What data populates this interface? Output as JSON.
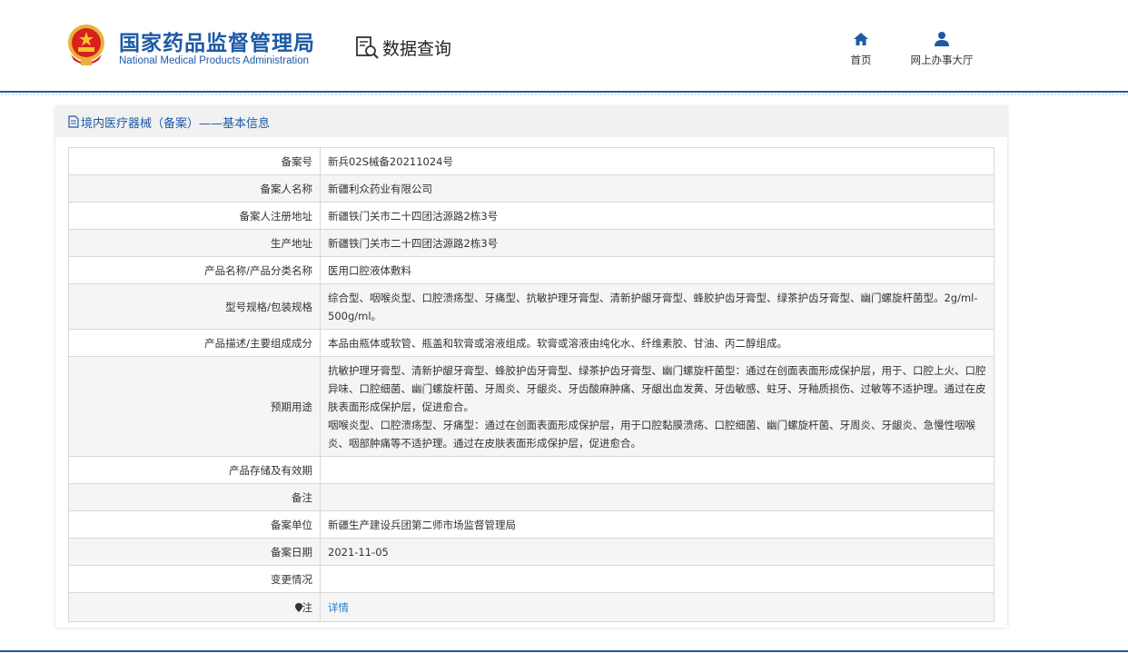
{
  "header": {
    "org_cn": "国家药品监督管理局",
    "org_en": "National Medical Products Administration",
    "query_label": "数据查询",
    "nav": [
      {
        "label": "首页",
        "icon": "home-icon"
      },
      {
        "label": "网上办事大厅",
        "icon": "user-icon"
      }
    ]
  },
  "panel": {
    "title": "境内医疗器械（备案）——基本信息"
  },
  "rows": [
    {
      "key": "备案号",
      "value": "新兵02S械备20211024号"
    },
    {
      "key": "备案人名称",
      "value": "新疆利众药业有限公司"
    },
    {
      "key": "备案人注册地址",
      "value": "新疆铁门关市二十四团沽源路2栋3号"
    },
    {
      "key": "生产地址",
      "value": "新疆铁门关市二十四团沽源路2栋3号"
    },
    {
      "key": "产品名称/产品分类名称",
      "value": "医用口腔液体敷料"
    },
    {
      "key": "型号规格/包装规格",
      "value": "综合型、咽喉炎型、口腔溃疡型、牙痛型、抗敏护理牙膏型、清新护龈牙膏型、蜂胶护齿牙膏型、绿茶护齿牙膏型、幽门螺旋杆菌型。2g/ml-500g/ml。"
    },
    {
      "key": "产品描述/主要组成成分",
      "value": "本品由瓶体或软管、瓶盖和软膏或溶液组成。软膏或溶液由纯化水、纤维素胶、甘油、丙二醇组成。"
    },
    {
      "key": "预期用途",
      "value": "抗敏护理牙膏型、清新护龈牙膏型、蜂胶护齿牙膏型、绿茶护齿牙膏型、幽门螺旋杆菌型：通过在创面表面形成保护层，用于、口腔上火、口腔异味、口腔细菌、幽门螺旋杆菌、牙周炎、牙龈炎、牙齿酸麻肿痛、牙龈出血发黄、牙齿敏感、蛀牙、牙釉质损伤、过敏等不适护理。通过在皮肤表面形成保护层，促进愈合。",
      "value2": "咽喉炎型、口腔溃疡型、牙痛型：通过在创面表面形成保护层，用于口腔黏膜溃疡、口腔细菌、幽门螺旋杆菌、牙周炎、牙龈炎、急慢性咽喉炎、咽部肿痛等不适护理。通过在皮肤表面形成保护层，促进愈合。"
    },
    {
      "key": "产品存储及有效期",
      "value": ""
    },
    {
      "key": "备注",
      "value": ""
    },
    {
      "key": "备案单位",
      "value": "新疆生产建设兵团第二师市场监督管理局"
    },
    {
      "key": "备案日期",
      "value": "2021-11-05"
    },
    {
      "key": "变更情况",
      "value": ""
    },
    {
      "key": "注",
      "value": "详情"
    }
  ],
  "colors": {
    "brand": "#1d5aa6",
    "link": "#1d7ad1"
  }
}
